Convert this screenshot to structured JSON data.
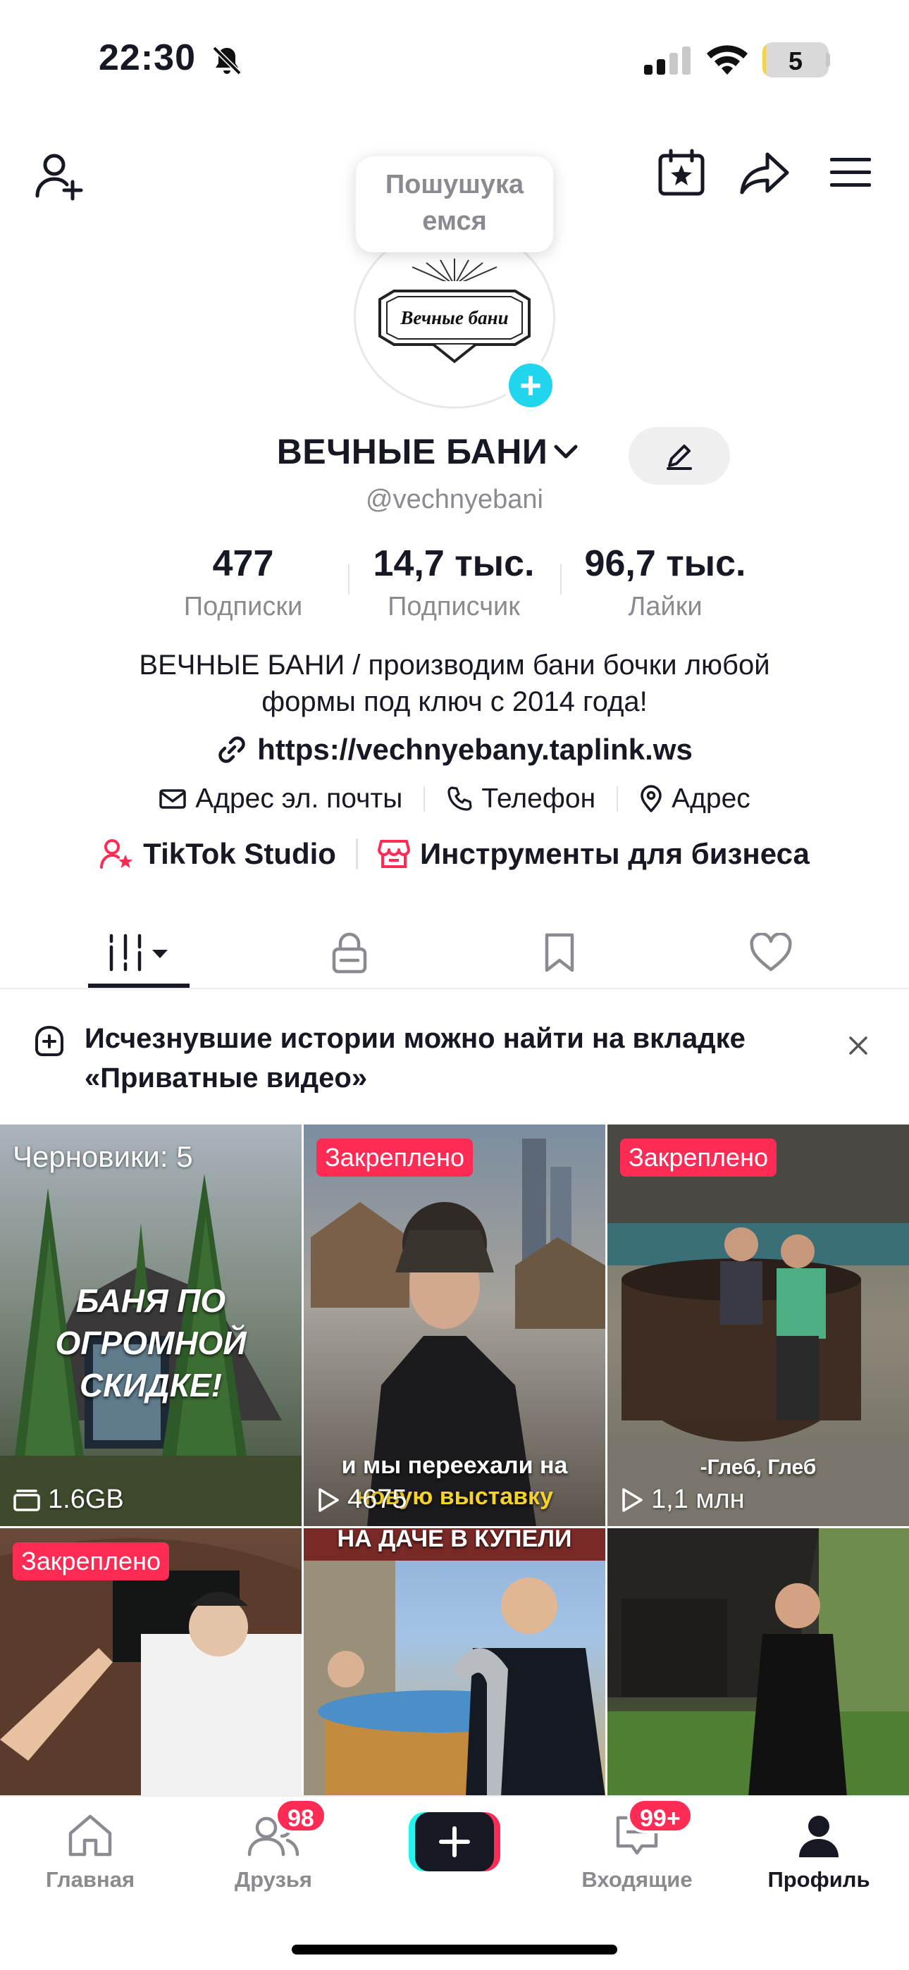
{
  "status_bar": {
    "time": "22:30",
    "battery": "5",
    "battery_level_percent": 5
  },
  "header": {
    "tooltip": "Пошушукаемся"
  },
  "profile": {
    "name": "ВЕЧНЫЕ БАНИ",
    "handle": "@vechnyebani",
    "logo_text": "Вечные бани",
    "stats": [
      {
        "value": "477",
        "label": "Подписки"
      },
      {
        "value": "14,7 тыс.",
        "label": "Подписчик"
      },
      {
        "value": "96,7 тыс.",
        "label": "Лайки"
      }
    ],
    "bio_line1": "ВЕЧНЫЕ БАНИ / производим бани бочки любой",
    "bio_line2": "формы под ключ с 2014 года!",
    "link": "https://vechnyebany.taplink.ws",
    "contacts": {
      "email": "Адрес эл. почты",
      "phone": "Телефон",
      "address": "Адрес"
    },
    "tools": {
      "studio": "TikTok Studio",
      "business": "Инструменты для бизнеса"
    }
  },
  "banner": {
    "text": "Исчезнувшие истории можно найти на вкладке «Приватные видео»"
  },
  "grid": {
    "drafts_label": "Черновики: 5",
    "drafts_size": "1.6GB",
    "pinned_label": "Закреплено",
    "video1_caption_1": "БАНЯ ПО ОГРОМНОЙ",
    "video1_caption_2": "СКИДКЕ!",
    "video2_views": "4675",
    "video2_caption_1": "и мы переехали на",
    "video2_caption_2": "новую выставку",
    "video3_views": "1,1 млн",
    "video3_caption": "-Глеб, Глеб",
    "video5_caption": "НА ДАЧЕ В КУПЕЛИ"
  },
  "nav": {
    "home": "Главная",
    "friends": "Друзья",
    "friends_badge": "98",
    "inbox": "Входящие",
    "inbox_badge": "99+",
    "profile": "Профиль"
  },
  "colors": {
    "accent": "#fe2c55",
    "cyan": "#20d5ec",
    "text": "#161823",
    "muted": "#8a8b91"
  }
}
